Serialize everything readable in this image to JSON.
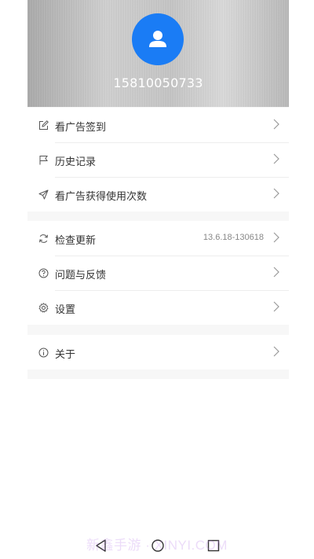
{
  "profile": {
    "phone": "15810050733"
  },
  "menu_group_1": [
    {
      "label": "看广告签到",
      "icon": "edit-icon"
    },
    {
      "label": "历史记录",
      "icon": "flag-icon"
    },
    {
      "label": "看广告获得使用次数",
      "icon": "send-icon"
    }
  ],
  "menu_group_2": [
    {
      "label": "检查更新",
      "icon": "refresh-icon",
      "value": "13.6.18-130618"
    },
    {
      "label": "问题与反馈",
      "icon": "question-circle-icon"
    },
    {
      "label": "设置",
      "icon": "gear-icon"
    }
  ],
  "menu_group_3": [
    {
      "label": "关于",
      "icon": "info-circle-icon"
    }
  ],
  "watermark": "新鑫手游 · XINYI.COM",
  "colors": {
    "accent": "#1a7cf5",
    "background": "#f7f7f7",
    "text": "#333333"
  }
}
